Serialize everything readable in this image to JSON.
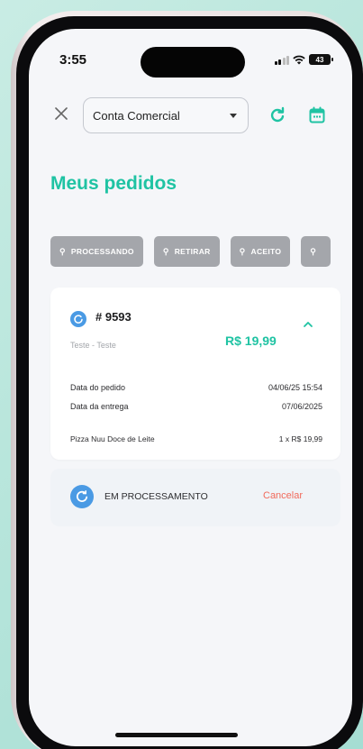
{
  "status_bar": {
    "time": "3:55",
    "battery": "43"
  },
  "header": {
    "account_select": "Conta Comercial"
  },
  "page": {
    "title": "Meus pedidos"
  },
  "filters": [
    {
      "label": "PROCESSANDO"
    },
    {
      "label": "RETIRAR"
    },
    {
      "label": "ACEITO"
    },
    {
      "label": ""
    }
  ],
  "order": {
    "id": "# 9593",
    "customer": "Teste - Teste",
    "total": "R$ 19,99",
    "details": [
      {
        "label": "Data do pedido",
        "value": "04/06/25 15:54"
      },
      {
        "label": "Data da entrega",
        "value": "07/06/2025"
      }
    ],
    "items": [
      {
        "name": "Pizza Nuu Doce de Leite",
        "qty_price": "1 x R$ 19,99"
      }
    ],
    "status": "EM PROCESSAMENTO",
    "cancel_label": "Cancelar"
  },
  "colors": {
    "accent": "#1fc3a3",
    "status_blue": "#4a9ae4",
    "cancel": "#f16a5c",
    "chip_bg": "#a4a6ab"
  }
}
